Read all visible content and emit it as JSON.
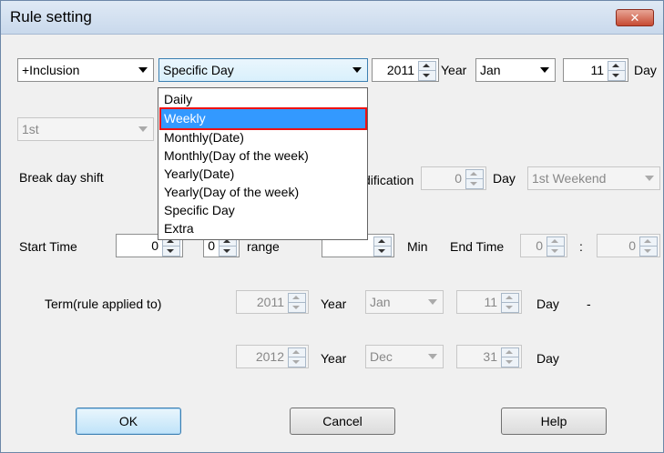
{
  "window": {
    "title": "Rule setting",
    "close_glyph": "✕"
  },
  "row1": {
    "mode_value": "+Inclusion",
    "rule_type_value": "Specific Day",
    "year_value": "2011",
    "year_label": "Year",
    "month_value": "Jan",
    "day_value": "11",
    "day_label": "Day"
  },
  "row2": {
    "ordinal_value": "1st"
  },
  "break": {
    "label": "Break day shift",
    "modification_label_visible": "dification",
    "shift_value": "0",
    "day_label": "Day",
    "weekend_value": "1st Weekend"
  },
  "time": {
    "start_label": "Start Time",
    "start_hour": "0",
    "start_min": "0",
    "range_label_visible": "range",
    "min_label": "Min",
    "end_label": "End Time",
    "end_hour": "0",
    "colon": ":",
    "end_min": "0"
  },
  "term": {
    "label": "Term(rule applied to)",
    "from_year": "2011",
    "from_year_label": "Year",
    "from_month": "Jan",
    "from_day": "11",
    "from_day_label": "Day",
    "dash": "-",
    "to_year": "2012",
    "to_year_label": "Year",
    "to_month": "Dec",
    "to_day": "31",
    "to_day_label": "Day"
  },
  "buttons": {
    "ok": "OK",
    "cancel": "Cancel",
    "help": "Help"
  },
  "rule_type_options": [
    "Daily",
    "Weekly",
    "Monthly(Date)",
    "Monthly(Day of the week)",
    "Yearly(Date)",
    "Yearly(Day of the week)",
    "Specific Day",
    "Extra"
  ],
  "highlighted_option": "Weekly",
  "colors": {
    "selection": "#3399ff",
    "highlight_border": "#ee1111",
    "close_button": "#c64b33"
  }
}
